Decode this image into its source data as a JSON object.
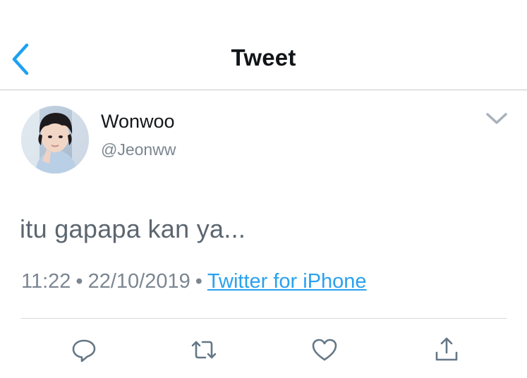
{
  "header": {
    "title": "Tweet",
    "back_icon": "chevron-left-icon"
  },
  "tweet": {
    "display_name": "Wonwoo",
    "handle": "@Jeonww",
    "text": "itu gapapa kan ya...",
    "time": "11:22",
    "date": "22/10/2019",
    "separator": "•",
    "source": "Twitter for iPhone"
  },
  "actions": [
    {
      "name": "reply",
      "icon": "reply-icon"
    },
    {
      "name": "retweet",
      "icon": "retweet-icon"
    },
    {
      "name": "like",
      "icon": "heart-icon"
    },
    {
      "name": "share",
      "icon": "share-icon"
    }
  ],
  "colors": {
    "accent": "#1da1f2",
    "link": "#2aa1ee",
    "secondary_text": "#7b8691",
    "icon": "#657786"
  }
}
